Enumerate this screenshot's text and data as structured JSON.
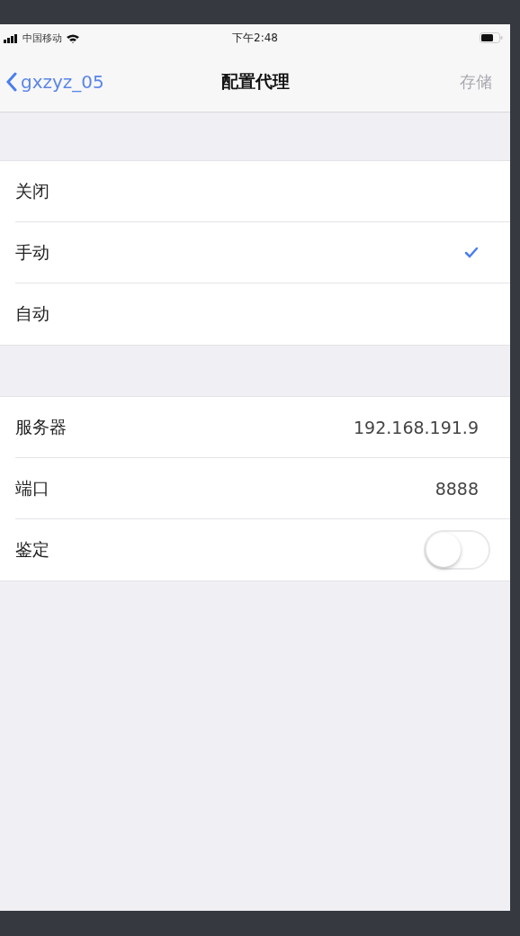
{
  "status_bar": {
    "carrier": "中国移动",
    "time": "下午2:48"
  },
  "nav": {
    "back": "gxzyz_05",
    "title": "配置代理",
    "save": {
      "label": "存储",
      "disabled": true
    }
  },
  "modes": [
    {
      "label": "关闭",
      "selected": false
    },
    {
      "label": "手动",
      "selected": true
    },
    {
      "label": "自动",
      "selected": false
    }
  ],
  "settings": [
    {
      "kind": "value",
      "label": "服务器",
      "value": "192.168.191.9"
    },
    {
      "kind": "value",
      "label": "端口",
      "value": "8888"
    },
    {
      "kind": "toggle",
      "label": "鉴定",
      "on": false
    }
  ]
}
